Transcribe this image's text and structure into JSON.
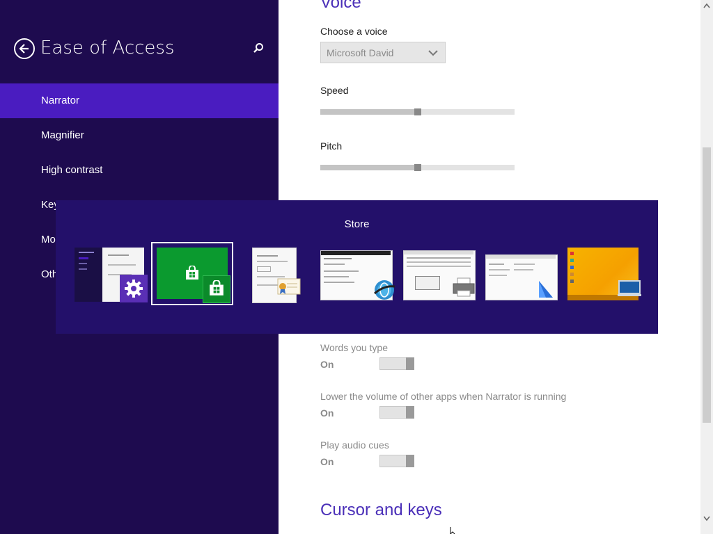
{
  "left_pane": {
    "title": "Ease of Access",
    "nav_items": [
      {
        "label": "Narrator",
        "selected": true
      },
      {
        "label": "Magnifier",
        "selected": false
      },
      {
        "label": "High contrast",
        "selected": false
      },
      {
        "label": "Key",
        "selected": false
      },
      {
        "label": "Mo",
        "selected": false
      },
      {
        "label": "Oth",
        "selected": false
      }
    ]
  },
  "content": {
    "voice_heading": "Voice",
    "choose_voice_label": "Choose a voice",
    "voice_selected": "Microsoft David",
    "speed_label": "Speed",
    "speed_level": 0.5,
    "pitch_label": "Pitch",
    "pitch_level": 0.5,
    "toggles": [
      {
        "label": "Words you type",
        "state": "On"
      },
      {
        "label": "Lower the volume of other apps when Narrator is running",
        "state": "On"
      },
      {
        "label": "Play audio cues",
        "state": "On"
      }
    ],
    "cursor_heading": "Cursor and keys"
  },
  "switcher": {
    "title": "Store",
    "apps": [
      {
        "icon": "gear-icon",
        "active": false
      },
      {
        "icon": "store-icon",
        "active": true
      },
      {
        "icon": "certificate-icon",
        "active": false
      },
      {
        "icon": "network-globe-icon",
        "active": false
      },
      {
        "icon": "printer-icon",
        "active": false
      },
      {
        "icon": "install-icon",
        "active": false
      },
      {
        "icon": "desktop-icon",
        "active": false
      }
    ]
  },
  "colors": {
    "left_pane_bg": "#1e0b4f",
    "selected_item_bg": "#4a1cc0",
    "switcher_bg": "#23106a",
    "heading_accent": "#4a2fb8",
    "store_green": "#0b9a2f",
    "settings_purple": "#5a2fb5"
  }
}
